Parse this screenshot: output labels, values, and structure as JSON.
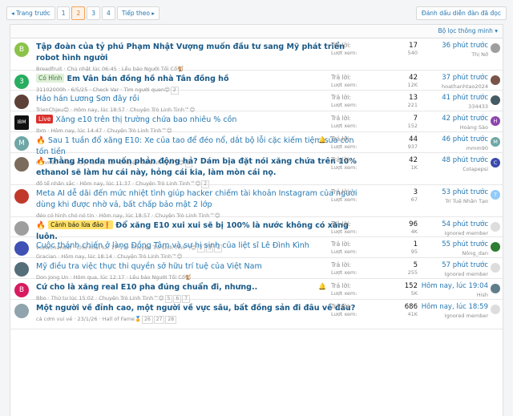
{
  "pager": {
    "prev": "◂ Trang trước",
    "pages": [
      "1",
      "2",
      "3",
      "4"
    ],
    "current": "2",
    "next": "Tiếp theo ▸"
  },
  "mark_read": "Đánh dấu diễn đàn đã đọc",
  "filter_label": "Bộ lọc thông minh ▾",
  "labels": {
    "replies": "Trả lời:",
    "views": "Lượt xem:"
  },
  "threads": [
    {
      "avatar": "B",
      "avatar_color": "#8bc34a",
      "prefix": "",
      "fire": false,
      "title": "Tập đoàn của tỷ phú Phạm Nhật Vượng muốn đầu tư sang Mỹ phát triển robot hình người",
      "meta": "Breadfruit · Chủ nhật lúc 06:45 · Lều báo Người Tối Cổ🐒",
      "pages": [],
      "replies": "17",
      "views": "540",
      "latest_time": "36 phút trước",
      "latest_user": "Thị Nở",
      "savatar_color": "#9e9e9e",
      "savatar_letter": "",
      "bold": true,
      "bell": false
    },
    {
      "avatar": "3",
      "avatar_color": "#27ae60",
      "prefix": "Có Hình",
      "prefix_bg": "#dff0d8",
      "prefix_color": "#3c763d",
      "fire": false,
      "title": "Em Vân bán đồng hồ nhà Tân đồng hồ",
      "meta": "31102000h · 6/5/25 · Check Var · Tìm người quen😊",
      "pages": [
        "2"
      ],
      "replies": "42",
      "views": "12K",
      "latest_time": "37 phút trước",
      "latest_user": "hoathanhtao2024",
      "savatar_color": "#795548",
      "savatar_letter": "",
      "bold": true,
      "bell": false
    },
    {
      "avatar": "",
      "avatar_color": "#5d4037",
      "prefix": "",
      "fire": false,
      "title": "Hảo hán Lương Sơn đây rồi",
      "meta": "TrienChjeu😊 · Hôm nay, lúc 18:57 · Chuyện Trò Linh Tinh™😊",
      "pages": [],
      "replies": "13",
      "views": "221",
      "latest_time": "41 phút trước",
      "latest_user": "334433",
      "savatar_color": "#455a64",
      "savatar_letter": "",
      "bold": false,
      "bell": false
    },
    {
      "avatar": "IBM",
      "avatar_color": "#111111",
      "prefix": "Live",
      "prefix_bg": "#d9302c",
      "prefix_color": "#ffffff",
      "fire": false,
      "title": "Xăng e10 trên thị trường chứa bao nhiêu % cồn",
      "meta": "Ibm · Hôm nay, lúc 14:47 · Chuyện Trò Linh Tinh™😊",
      "pages": [],
      "replies": "7",
      "views": "152",
      "latest_time": "42 phút trước",
      "latest_user": "Hoàng Sào",
      "savatar_color": "#8e44ad",
      "savatar_letter": "H",
      "bold": false,
      "bell": false
    },
    {
      "avatar": "M",
      "avatar_color": "#6fa6a6",
      "prefix": "",
      "fire": true,
      "title": "Sau 1 tuần đổ xăng E10: Xe của tao để đéo nổ, dắt bộ lỗi cặc kiếm tiệm sửa còn tốn tiền",
      "meta": "mmm90 · Hôm nay, lúc 11:13 · Chuyện Trò Linh Tinh™😊",
      "pages": [
        "2"
      ],
      "replies": "44",
      "views": "937",
      "latest_time": "46 phút trước",
      "latest_user": "mmm90",
      "savatar_color": "#6fa6a6",
      "savatar_letter": "M",
      "bold": false,
      "bell": true
    },
    {
      "avatar": "",
      "avatar_color": "#7b6b5a",
      "prefix": "",
      "fire": true,
      "title": "Thằng Honda muốn phản động hả? Dám bịa đặt nói xăng chứa trên 10% ethanol sẽ làm hư cái này, hỏng cái kia, làm mòn cái nọ.",
      "meta": "đồ tể nhân sắc · Hôm nay, lúc 11:37 · Chuyện Trò Linh Tinh™😊",
      "pages": [
        "2"
      ],
      "replies": "42",
      "views": "1K",
      "latest_time": "48 phút trước",
      "latest_user": "Colapepsi",
      "savatar_color": "#3949ab",
      "savatar_letter": "C",
      "bold": true,
      "bell": false
    },
    {
      "avatar": "",
      "avatar_color": "#c0392b",
      "prefix": "",
      "fire": false,
      "title": "Meta AI dễ dãi đến mức nhiệt tình giúp hacker chiếm tài khoản Instagram của người dùng khi được nhờ vả, bất chấp bảo mật 2 lớp",
      "meta": "đéo có hình chó nó tin · Hôm nay, lúc 18:57 · Chuyện Trò Linh Tinh™😊",
      "pages": [],
      "replies": "3",
      "views": "67",
      "latest_time": "53 phút trước",
      "latest_user": "Trí Tuệ Nhân Tạo",
      "savatar_color": "#90caf9",
      "savatar_letter": "T",
      "bold": false,
      "bell": false
    },
    {
      "avatar": "",
      "avatar_color": "#9e9e9e",
      "prefix": "Cảnh báo lừa đảo❗",
      "prefix_bg": "#ffe066",
      "prefix_color": "#141414",
      "fire": true,
      "title": "Đổ xăng E10 xui xui sẽ bị 100% là nước không có xăng luôn.",
      "meta": "vozerchandat · Chủ nhật lúc 17:17 · Chuyện Trò Linh Tinh™😊",
      "pages": [
        "2",
        "3",
        "4"
      ],
      "replies": "96",
      "views": "4K",
      "latest_time": "54 phút trước",
      "latest_user": "Ignored member",
      "savatar_color": "#dddddd",
      "savatar_letter": "",
      "bold": true,
      "bell": false
    },
    {
      "avatar": "",
      "avatar_color": "#3f51b5",
      "prefix": "",
      "fire": false,
      "title": "Cuộc thánh chiến ở làng Đồng Tâm và sự hi sinh của liệt sĩ Lê Đình Kình",
      "meta": "Gracian · Hôm nay, lúc 18:14 · Chuyện Trò Linh Tinh™😊",
      "pages": [],
      "replies": "1",
      "views": "95",
      "latest_time": "55 phút trước",
      "latest_user": "Nông_dan",
      "savatar_color": "#2e7d32",
      "savatar_letter": "",
      "bold": false,
      "bell": false
    },
    {
      "avatar": "",
      "avatar_color": "#546e7a",
      "prefix": "",
      "fire": false,
      "title": "Mỹ điều tra việc thực thi quyền sở hữu trí tuệ của Việt Nam",
      "meta": "Don Jong Un · Hôm qua, lúc 12:17 · Lều báo Người Tối Cổ🐒",
      "pages": [],
      "replies": "5",
      "views": "255",
      "latest_time": "57 phút trước",
      "latest_user": "Ignored member",
      "savatar_color": "#dddddd",
      "savatar_letter": "",
      "bold": false,
      "bell": false
    },
    {
      "avatar": "B",
      "avatar_color": "#d81b60",
      "prefix": "",
      "fire": false,
      "title": "Cứ cho là xăng real E10 pha đúng chuẩn đi, nhưng..",
      "meta": "Bbo · Thứ tư lúc 15:02 · Chuyện Trò Linh Tinh™😊",
      "pages": [
        "5",
        "6",
        "7"
      ],
      "replies": "152",
      "views": "5K",
      "latest_time": "Hôm nay, lúc 19:04",
      "latest_user": "Hish",
      "savatar_color": "#607d8b",
      "savatar_letter": "",
      "bold": true,
      "bell": true
    },
    {
      "avatar": "",
      "avatar_color": "#90a4ae",
      "prefix": "",
      "fire": false,
      "title": "Một người về đỉnh cao, một người về vực sâu, bất đồng sản đi đâu về đâu?",
      "meta": "cá cơm vui vẻ · 23/1/26 · Hall of Fame🏅",
      "pages": [
        "26",
        "27",
        "28"
      ],
      "replies": "686",
      "views": "41K",
      "latest_time": "Hôm nay, lúc 18:59",
      "latest_user": "Ignored member",
      "savatar_color": "#dddddd",
      "savatar_letter": "",
      "bold": true,
      "bell": false
    }
  ]
}
